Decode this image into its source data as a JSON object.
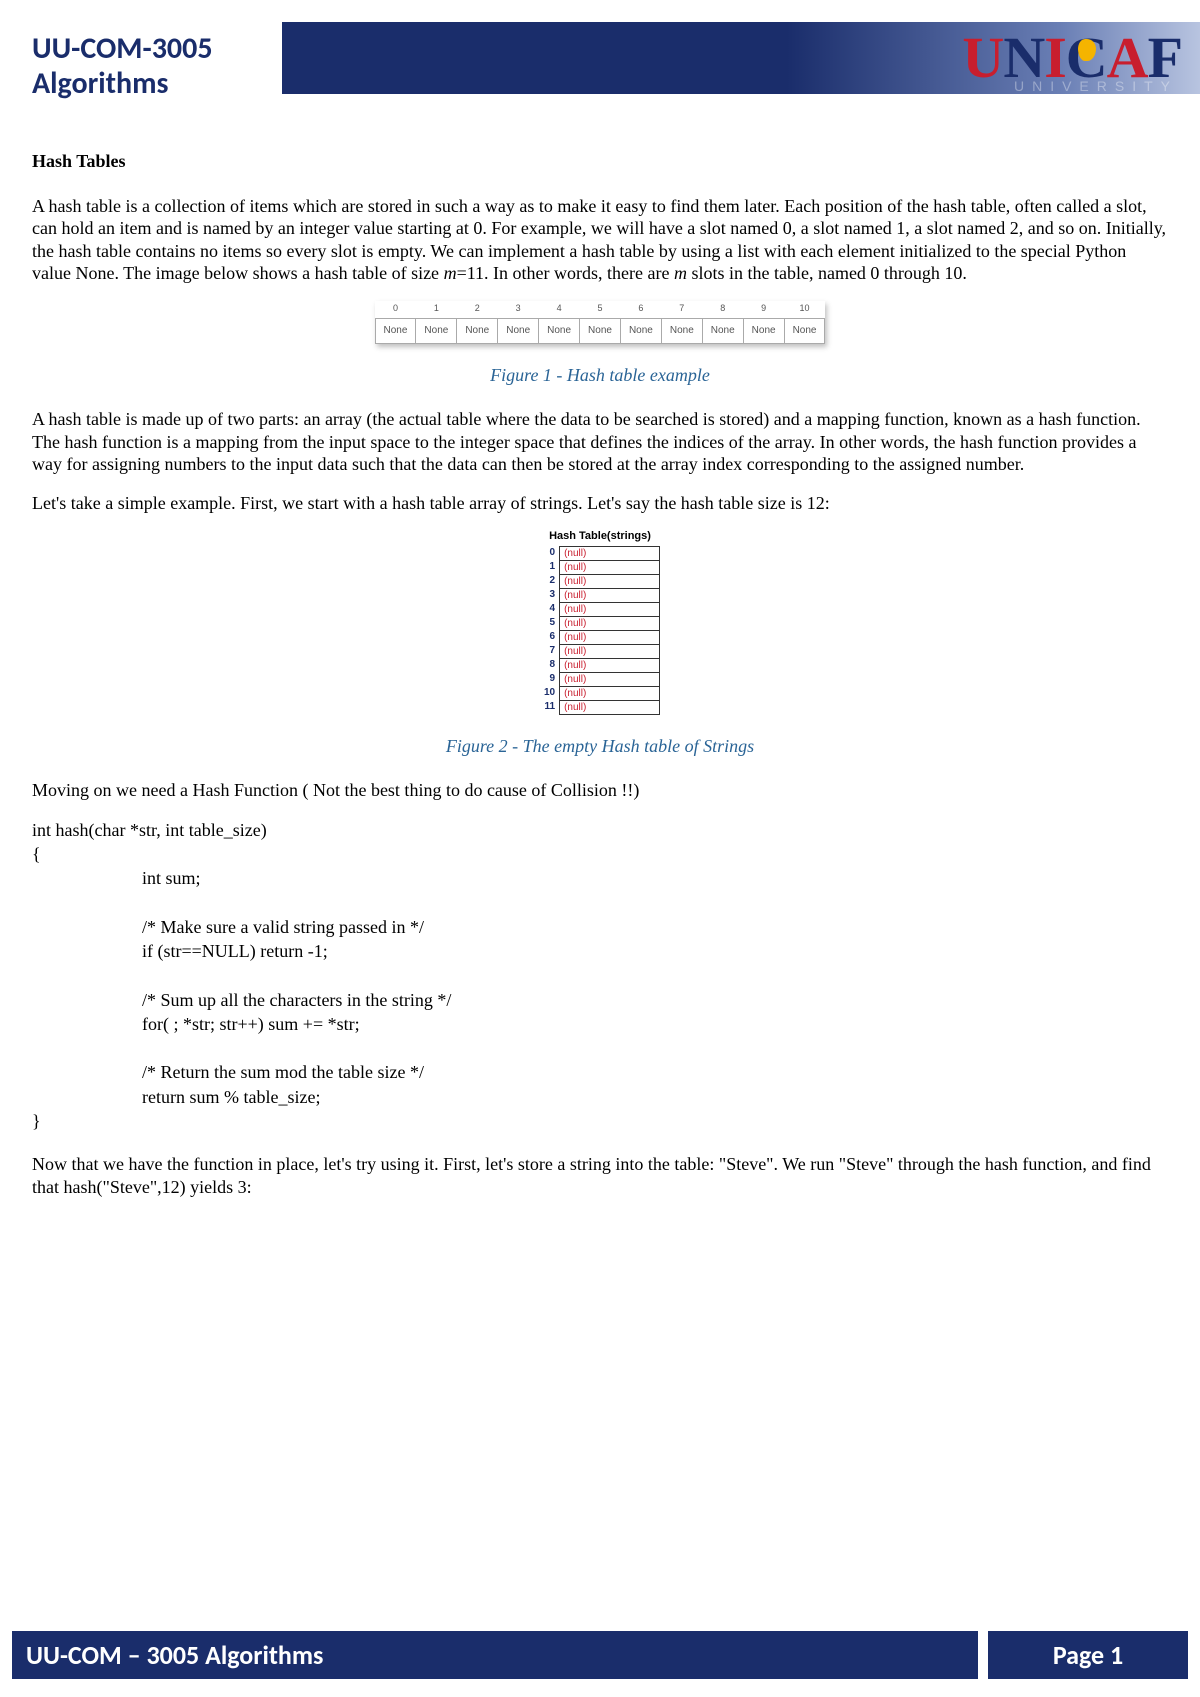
{
  "header": {
    "course_code": "UU-COM-3005",
    "course_name": "Algorithms",
    "logo_main": "UNICAF",
    "logo_sub": "UNIVERSITY"
  },
  "body": {
    "h_hash_tables": "Hash Tables",
    "p1_a": "A hash table is a collection of items which are stored in such a way as to make it easy to find them later. Each position of the hash table, often called a slot, can hold an item and is named by an integer value starting at 0. For example, we will have a slot named 0, a slot named 1, a slot named 2, and so on. Initially, the hash table contains no items so every slot is empty. We can implement a hash table by using a list with each element initialized to the special Python value None. The image below shows a hash table of size ",
    "p1_m": "m",
    "p1_b": "=11. In other words, there are ",
    "p1_m2": "m",
    "p1_c": " slots in the table, named 0 through 10.",
    "fig1_caption": "Figure 1 - Hash table example",
    "p2": "A hash table is made up of two parts: an array (the actual table where the data to be searched is stored) and a mapping function, known as a hash function. The hash function is a mapping from the input space to the integer space that defines the indices of the array. In other words, the hash function provides a way for assigning numbers to the input data such that the data can then be stored at the array index corresponding to the assigned number.",
    "p3": "Let's take a simple example. First, we start with a hash table array of strings. Let's say the hash table size is 12:",
    "fig2_title": "Hash Table(strings)",
    "fig2_caption": "Figure 2 - The empty Hash table of Strings",
    "p4": "Moving on we need a Hash Function ( Not the best thing to do cause of Collision !!)",
    "code_sig": "int hash(char *str, int table_size)",
    "code_open": "{",
    "code_l1": "int sum;",
    "code_l2": "/* Make sure a valid string passed in */",
    "code_l3": "if (str==NULL) return -1;",
    "code_l4": "/* Sum up all the characters in the string */",
    "code_l5": "for( ; *str; str++) sum += *str;",
    "code_l6": "/* Return the sum mod the table size */",
    "code_l7": "return sum % table_size;",
    "code_close": "}",
    "p5": "Now that we have the function in place, let's try using it. First, let's store a string into the table: \"Steve\". We run \"Steve\" through the hash function, and find that hash(\"Steve\",12) yields 3:"
  },
  "fig1": {
    "indices": [
      "0",
      "1",
      "2",
      "3",
      "4",
      "5",
      "6",
      "7",
      "8",
      "9",
      "10"
    ],
    "cells": [
      "None",
      "None",
      "None",
      "None",
      "None",
      "None",
      "None",
      "None",
      "None",
      "None",
      "None"
    ]
  },
  "fig2": {
    "rows": [
      {
        "idx": "0",
        "val": "(null)"
      },
      {
        "idx": "1",
        "val": "(null)"
      },
      {
        "idx": "2",
        "val": "(null)"
      },
      {
        "idx": "3",
        "val": "(null)"
      },
      {
        "idx": "4",
        "val": "(null)"
      },
      {
        "idx": "5",
        "val": "(null)"
      },
      {
        "idx": "6",
        "val": "(null)"
      },
      {
        "idx": "7",
        "val": "(null)"
      },
      {
        "idx": "8",
        "val": "(null)"
      },
      {
        "idx": "9",
        "val": "(null)"
      },
      {
        "idx": "10",
        "val": "(null)"
      },
      {
        "idx": "11",
        "val": "(null)"
      }
    ]
  },
  "footer": {
    "left": "UU-COM – 3005 Algorithms",
    "right": "Page 1"
  }
}
